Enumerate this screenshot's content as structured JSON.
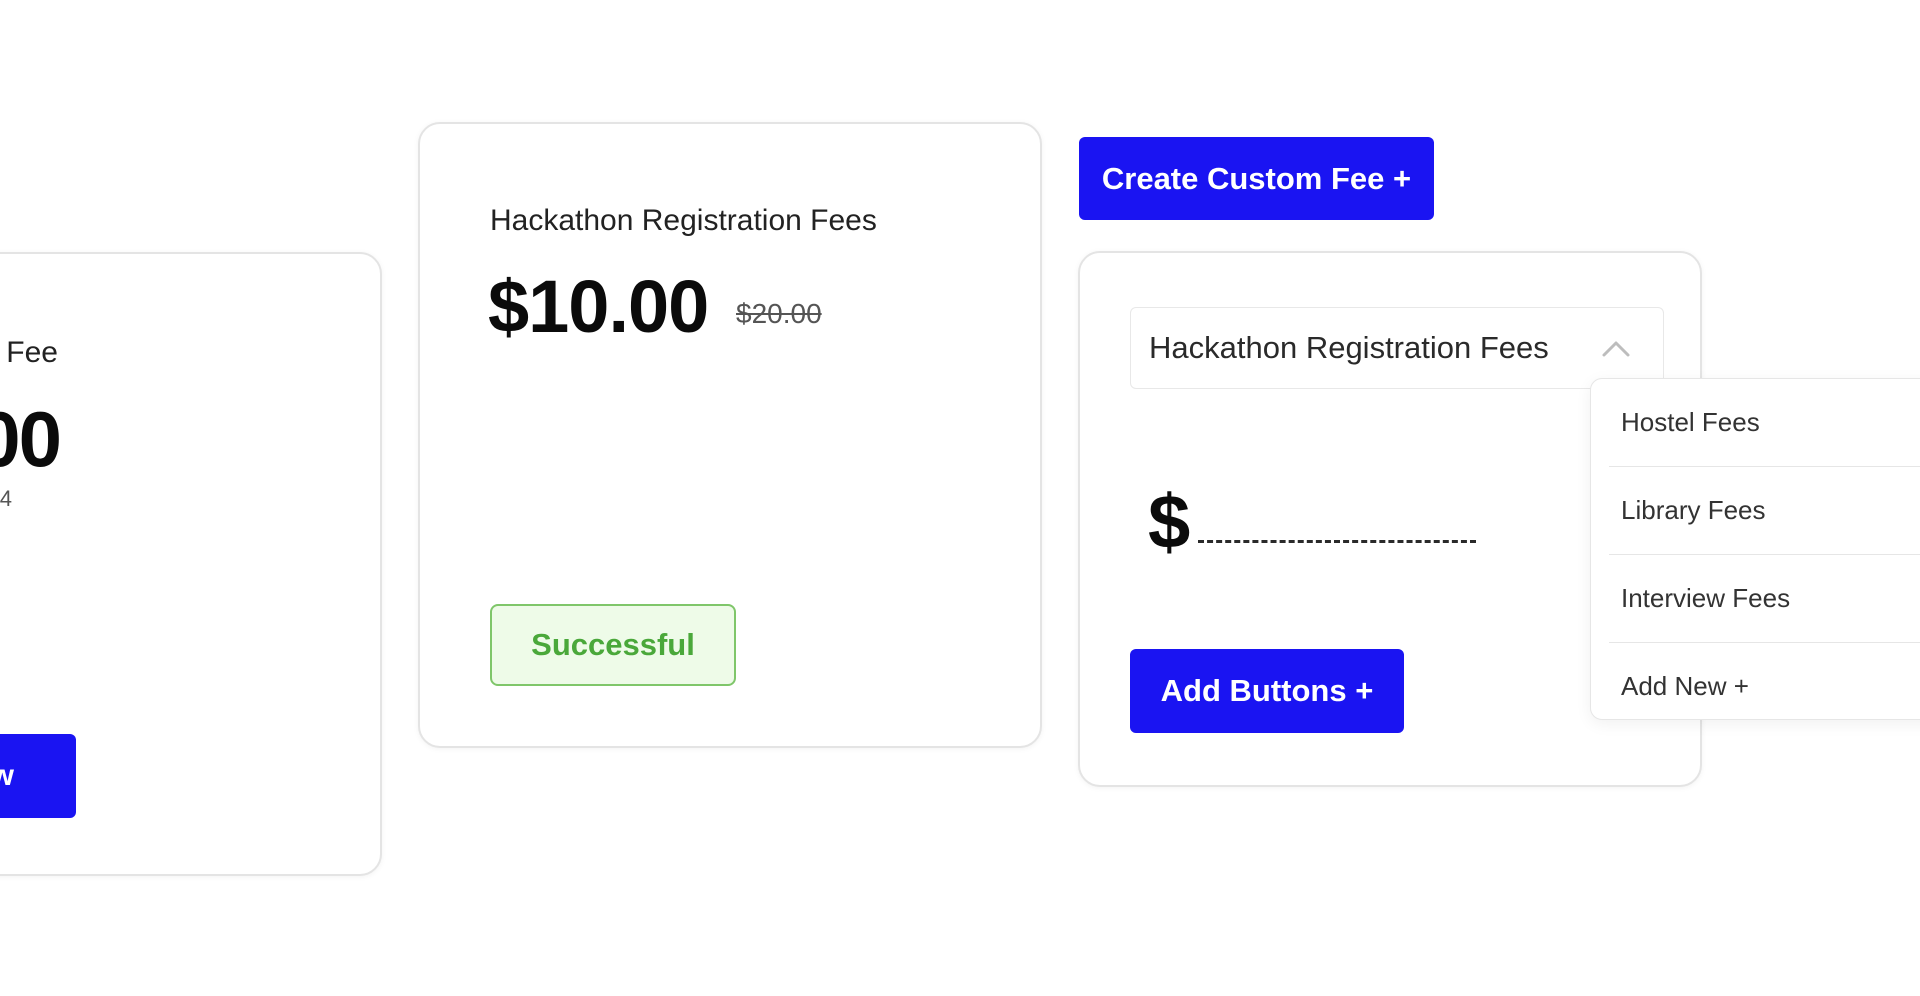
{
  "left_card": {
    "title": "Fee",
    "price": "00",
    "subtext": "4",
    "button_label": "w"
  },
  "middle_card": {
    "title": "Hackathon Registration Fees",
    "price": "$10.00",
    "old_price": "$20.00",
    "status": "Successful"
  },
  "create_button": {
    "label": "Create Custom Fee +"
  },
  "right_card": {
    "selected_fee": "Hackathon Registration Fees",
    "chevron_icon": "chevron-up-icon",
    "currency_symbol": "$",
    "add_button_label": "Add Buttons +"
  },
  "dropdown": {
    "items": [
      {
        "label": "Hostel Fees"
      },
      {
        "label": "Library Fees"
      },
      {
        "label": "Interview Fees"
      },
      {
        "label": "Add New +"
      }
    ]
  },
  "colors": {
    "accent": "#1a14f2",
    "success_text": "#4aa83a",
    "success_bg": "#eefbe8",
    "success_border": "#7fc66a"
  }
}
